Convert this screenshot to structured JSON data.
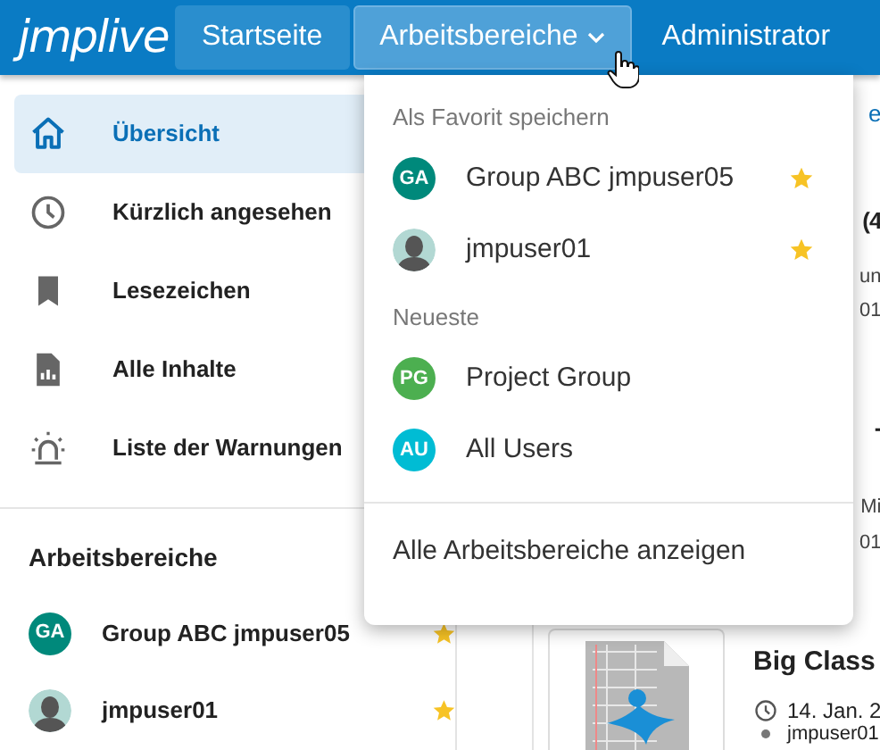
{
  "brand": {
    "logo": "jmplive"
  },
  "nav": [
    {
      "label": "Startseite",
      "selected": true,
      "expanded": false
    },
    {
      "label": "Arbeitsbereiche",
      "selected": false,
      "expanded": true
    },
    {
      "label": "Administrator",
      "selected": false,
      "expanded": false
    }
  ],
  "sidebar": {
    "items": [
      {
        "label": "Übersicht",
        "kind": "home",
        "selected": true
      },
      {
        "label": "Kürzlich angesehen",
        "kind": "clock",
        "selected": false
      },
      {
        "label": "Lesezeichen",
        "kind": "bookmark",
        "selected": false
      },
      {
        "label": "Alle Inhalte",
        "kind": "report",
        "selected": false
      },
      {
        "label": "Liste der Warnungen",
        "kind": "alarm",
        "selected": false
      }
    ],
    "workspaces_heading": "Arbeitsbereiche",
    "workspaces": [
      {
        "kind": "initials",
        "initials": "GA",
        "color": "#00897b",
        "name": "Group ABC jmpuser05",
        "favorite": true
      },
      {
        "kind": "person",
        "name": "jmpuser01",
        "favorite": true
      }
    ]
  },
  "dropdown": {
    "sections": [
      {
        "heading": "Als Favorit speichern",
        "items": [
          {
            "kind": "initials",
            "initials": "GA",
            "color": "#00897b",
            "name": "Group ABC jmpuser05",
            "favorite": true
          },
          {
            "kind": "person",
            "name": "jmpuser01",
            "favorite": true
          }
        ]
      },
      {
        "heading": "Neueste",
        "items": [
          {
            "kind": "initials",
            "initials": "PG",
            "color": "#4caf50",
            "name": "Project Group",
            "favorite": false
          },
          {
            "kind": "initials",
            "initials": "AU",
            "color": "#00bcd4",
            "name": "All Users",
            "favorite": false
          }
        ]
      }
    ],
    "footer_link": "Alle Arbeitsbereiche anzeigen"
  },
  "content": {
    "peek": [
      {
        "kind": "link",
        "text": "e"
      },
      {
        "kind": "title",
        "text": "(4"
      },
      {
        "kind": "meta",
        "text": "un"
      },
      {
        "kind": "meta",
        "text": "01"
      },
      {
        "kind": "title",
        "text": "-"
      },
      {
        "kind": "meta",
        "text": "Mi"
      },
      {
        "kind": "meta",
        "text": "01"
      }
    ],
    "card": {
      "title": "Big Class",
      "date": "14. Jan. 2",
      "owner": "jmpuser01"
    }
  }
}
